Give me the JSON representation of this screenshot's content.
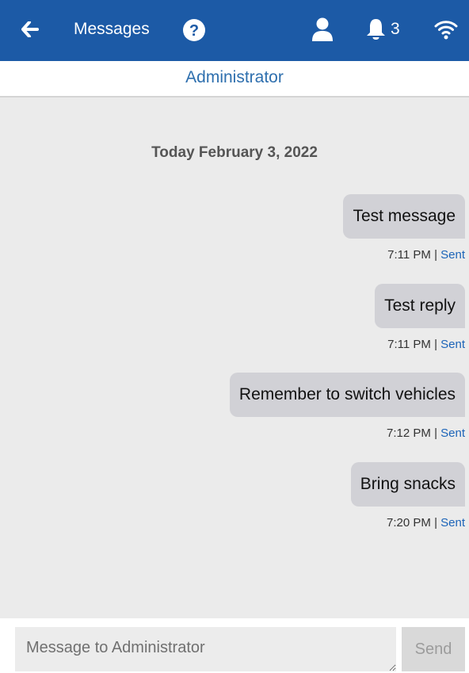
{
  "header": {
    "title": "Messages",
    "notification_count": "3",
    "icons": [
      "back-arrow-icon",
      "help-icon",
      "user-icon",
      "bell-icon",
      "wifi-icon"
    ],
    "background": "#1c5aa6"
  },
  "conversation": {
    "recipient": "Administrator",
    "date_label": "Today February 3, 2022",
    "messages": [
      {
        "text": "Test message",
        "time": "7:11 PM",
        "separator": " | ",
        "status": "Sent"
      },
      {
        "text": "Test reply",
        "time": "7:11 PM",
        "separator": " | ",
        "status": "Sent"
      },
      {
        "text": "Remember to switch vehicles",
        "time": "7:12 PM",
        "separator": " | ",
        "status": "Sent"
      },
      {
        "text": "Bring snacks",
        "time": "7:20 PM",
        "separator": " | ",
        "status": "Sent"
      }
    ]
  },
  "composer": {
    "placeholder": "Message to Administrator",
    "value": "",
    "send_label": "Send"
  }
}
